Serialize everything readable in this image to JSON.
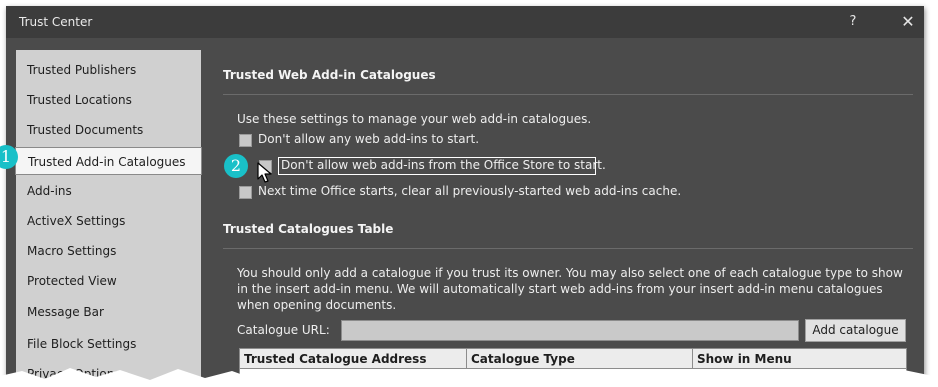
{
  "window": {
    "title": "Trust Center",
    "help_glyph": "?",
    "close_glyph": "✕"
  },
  "sidebar": {
    "items": [
      {
        "label": "Trusted Publishers"
      },
      {
        "label": "Trusted Locations"
      },
      {
        "label": "Trusted Documents"
      },
      {
        "label": "Trusted Add-in Catalogues",
        "selected": true
      },
      {
        "label": "Add-ins"
      },
      {
        "label": "ActiveX Settings"
      },
      {
        "label": "Macro Settings"
      },
      {
        "label": "Protected View"
      },
      {
        "label": "Message Bar"
      },
      {
        "label": "File Block Settings"
      },
      {
        "label": "Privacy Options"
      }
    ]
  },
  "callouts": {
    "one": "1",
    "two": "2"
  },
  "web_catalogues": {
    "heading": "Trusted Web Add-in Catalogues",
    "intro": "Use these settings to manage your web add-in catalogues.",
    "options": [
      {
        "label": "Don't allow any web add-ins to start.",
        "checked": false
      },
      {
        "label": "Don't allow web add-ins from the Office Store to start.",
        "checked": false,
        "focused": true
      },
      {
        "label": "Next time Office starts, clear all previously-started web add-ins cache.",
        "checked": false
      }
    ]
  },
  "catalogues_table": {
    "heading": "Trusted Catalogues Table",
    "description": "You should only add a catalogue if you trust its owner. You may also select one of each catalogue type to show in the insert add-in menu. We will automatically start web add-ins from your insert add-in menu catalogues when opening documents.",
    "url_label": "Catalogue URL:",
    "url_value": "",
    "add_button": "Add catalogue",
    "columns": [
      "Trusted Catalogue Address",
      "Catalogue Type",
      "Show in Menu"
    ]
  },
  "colors": {
    "background": "#4b4b4b",
    "titlebar": "#3c3c3c",
    "sidebar": "#d0d0d0",
    "callout": "#19c0c8"
  }
}
